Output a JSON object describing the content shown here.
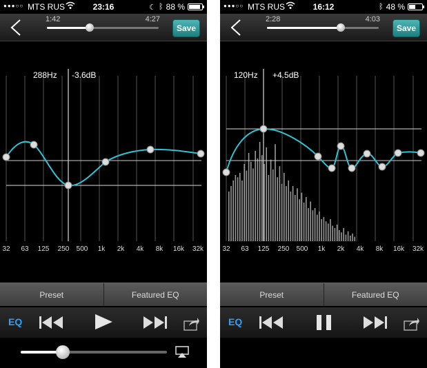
{
  "colors": {
    "curve": "#2ec4d6",
    "accent": "#29a3ff",
    "save": "#2a9090"
  },
  "icons": {
    "back": "chevron-left-icon",
    "prev": "skip-back-icon",
    "play": "play-icon",
    "pause": "pause-icon",
    "next": "skip-forward-icon",
    "share": "share-icon",
    "airplay": "airplay-icon",
    "wifi": "wifi-icon",
    "bluetooth": "bluetooth-icon",
    "moon": "moon-icon"
  },
  "freq_labels": [
    "32",
    "63",
    "125",
    "250",
    "500",
    "1k",
    "2k",
    "4k",
    "8k",
    "16k",
    "32k"
  ],
  "screens": [
    {
      "status": {
        "carrier": "MTS RUS",
        "time": "23:16",
        "battery": "88 %",
        "battery_level": 0.88,
        "dnd": true
      },
      "player": {
        "elapsed": "1:42",
        "total": "4:27",
        "progress": 0.38
      },
      "save_label": "Save",
      "readout": {
        "freq": "288Hz",
        "gain": "-3.6dB",
        "selected_index": 3
      },
      "eq_points": [
        0.0,
        2.2,
        null,
        -3.6,
        null,
        -0.2,
        null,
        1.8,
        null,
        null,
        1.2
      ],
      "eq_curve": "smooth",
      "spectrum": [],
      "tabs": [
        "Preset",
        "Featured EQ"
      ],
      "eq_label": "EQ",
      "is_playing": false,
      "volume": 0.21,
      "show_volume": true
    },
    {
      "status": {
        "carrier": "MTS RUS",
        "time": "16:12",
        "battery": "48 %",
        "battery_level": 0.48,
        "dnd": false
      },
      "player": {
        "elapsed": "2:28",
        "total": "4:03",
        "progress": 0.66
      },
      "save_label": "Save",
      "readout": {
        "freq": "120Hz",
        "gain": "+4.5dB",
        "selected_index": 2
      },
      "eq_points": [
        -1.7,
        null,
        4.5,
        null,
        null,
        0.6,
        -0.8,
        1.8,
        0.6,
        -0.8,
        0.9,
        1.0
      ],
      "eq_curve": "wavy",
      "spectrum": [
        0.45,
        0.5,
        0.55,
        0.6,
        0.58,
        0.62,
        0.55,
        0.7,
        0.64,
        0.8,
        0.72,
        0.66,
        0.82,
        0.75,
        0.9,
        0.78,
        0.7,
        0.85,
        0.6,
        0.74,
        0.65,
        0.88,
        0.58,
        0.68,
        0.52,
        0.62,
        0.5,
        0.55,
        0.45,
        0.5,
        0.42,
        0.48,
        0.38,
        0.44,
        0.35,
        0.4,
        0.3,
        0.36,
        0.28,
        0.3,
        0.24,
        0.27,
        0.2,
        0.22,
        0.18,
        0.16,
        0.2,
        0.14,
        0.12,
        0.15,
        0.1,
        0.08,
        0.12,
        0.06,
        0.09,
        0.05,
        0.07,
        0.04
      ],
      "tabs": [
        "Preset",
        "Featured EQ"
      ],
      "eq_label": "EQ",
      "is_playing": true,
      "volume": null,
      "show_volume": false
    }
  ]
}
